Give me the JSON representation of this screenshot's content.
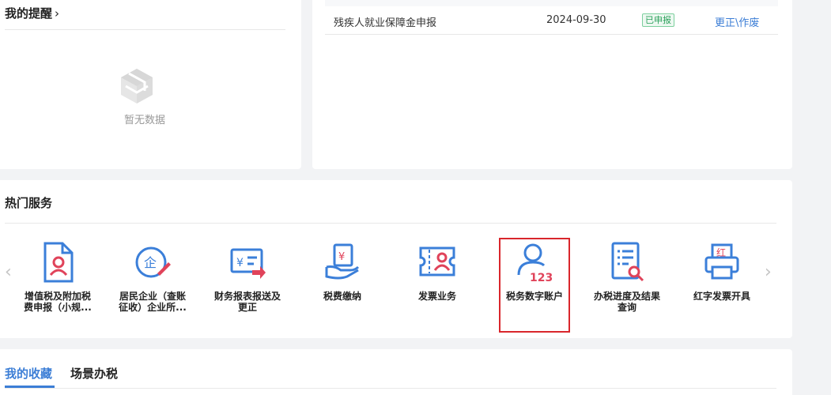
{
  "reminders": {
    "title": "我的提醒",
    "chevron": "›",
    "empty_icon": "cube-empty-icon",
    "empty_text": "暂无数据"
  },
  "declarations": {
    "rows": [
      {
        "name": "残疾人就业保障金申报",
        "date": "2024-09-30",
        "status": "已申报",
        "action": "更正\\作废"
      }
    ]
  },
  "hot_services": {
    "title": "热门服务",
    "arrow_left": "‹",
    "arrow_right": "›",
    "items": [
      {
        "label_line1": "增值税及附加税",
        "label_line2": "费申报（小规...",
        "icon": "vat-declaration-icon"
      },
      {
        "label_line1": "居民企业（查账",
        "label_line2": "征收）企业所...",
        "icon": "enterprise-tax-icon"
      },
      {
        "label_line1": "财务报表报送及",
        "label_line2": "更正",
        "icon": "financial-report-icon"
      },
      {
        "label_line1": "税费缴纳",
        "label_line2": "",
        "icon": "tax-payment-icon"
      },
      {
        "label_line1": "发票业务",
        "label_line2": "",
        "icon": "invoice-business-icon"
      },
      {
        "label_line1": "税务数字账户",
        "label_line2": "",
        "icon": "digital-account-icon"
      },
      {
        "label_line1": "办税进度及结果",
        "label_line2": "查询",
        "icon": "progress-query-icon"
      },
      {
        "label_line1": "红字发票开具",
        "label_line2": "",
        "icon": "red-invoice-icon"
      }
    ],
    "selected_index": 5,
    "colors": {
      "icon_blue": "#3b7fd9",
      "icon_red": "#e0435a",
      "selection_border": "#d9262c"
    }
  },
  "favorites": {
    "tabs": [
      "我的收藏",
      "场景办税"
    ],
    "active_tab": 0,
    "accent": "#3c7ed6"
  }
}
